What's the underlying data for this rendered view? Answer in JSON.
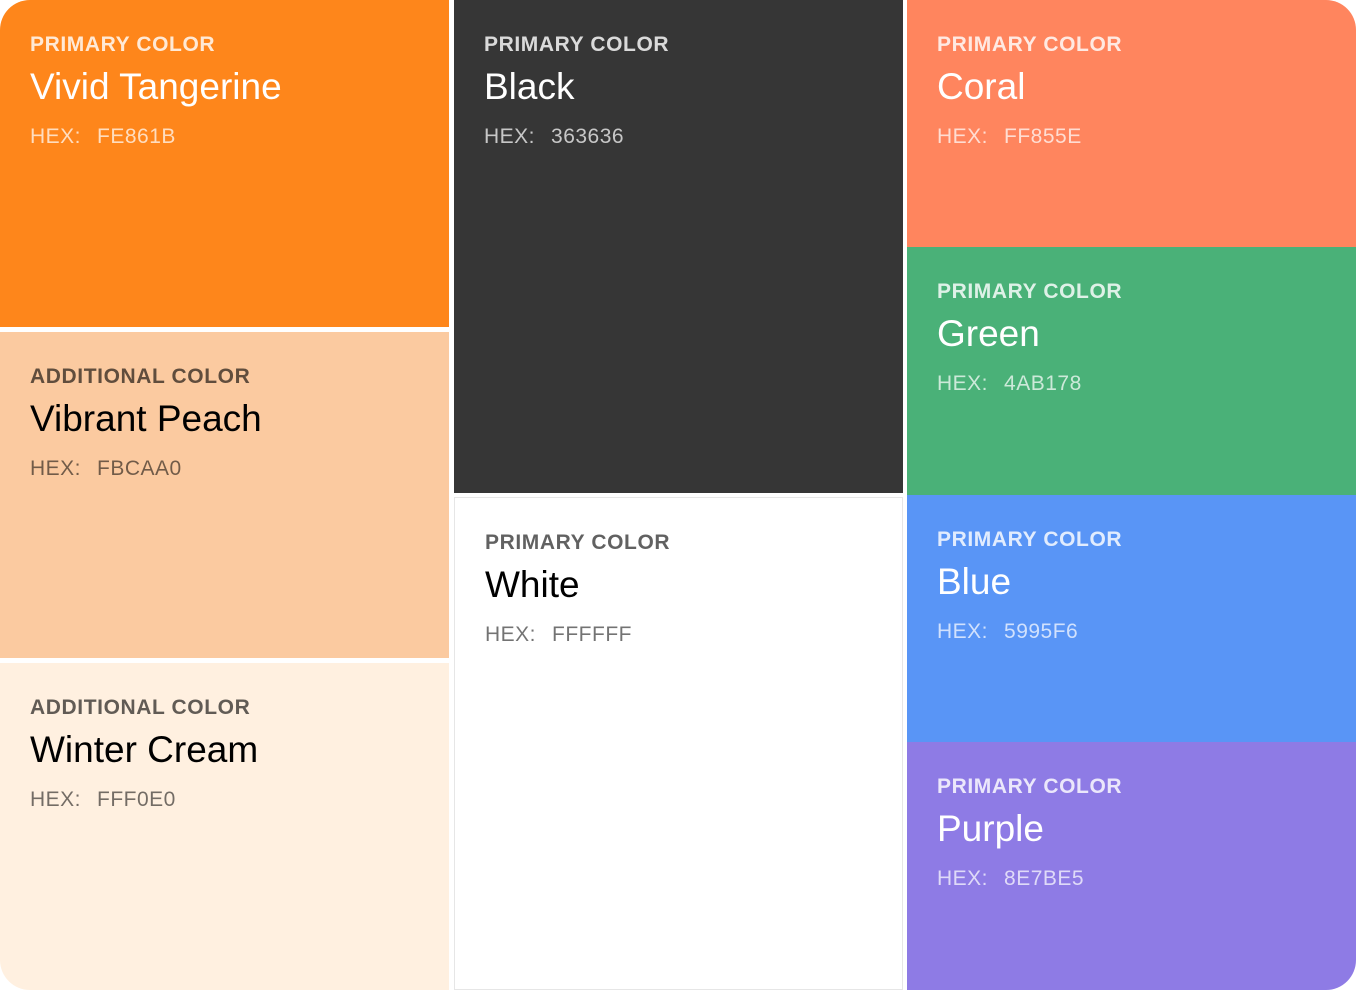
{
  "swatches": {
    "tangerine": {
      "kicker": "PRIMARY COLOR",
      "name": "Vivid Tangerine",
      "hex_label": "HEX:",
      "hex": "FE861B",
      "color": "#FE861B"
    },
    "peach": {
      "kicker": "ADDITIONAL COLOR",
      "name": "Vibrant Peach",
      "hex_label": "HEX:",
      "hex": "FBCAA0",
      "color": "#FBCAA0"
    },
    "cream": {
      "kicker": "ADDITIONAL COLOR",
      "name": "Winter Cream",
      "hex_label": "HEX:",
      "hex": "FFF0E0",
      "color": "#FFF0E0"
    },
    "black": {
      "kicker": "PRIMARY COLOR",
      "name": "Black",
      "hex_label": "HEX:",
      "hex": "363636",
      "color": "#363636"
    },
    "white": {
      "kicker": "PRIMARY COLOR",
      "name": "White",
      "hex_label": "HEX:",
      "hex": "FFFFFF",
      "color": "#FFFFFF"
    },
    "coral": {
      "kicker": "PRIMARY COLOR",
      "name": "Coral",
      "hex_label": "HEX:",
      "hex": "FF855E",
      "color": "#FF855E"
    },
    "green": {
      "kicker": "PRIMARY COLOR",
      "name": "Green",
      "hex_label": "HEX:",
      "hex": "4AB178",
      "color": "#4AB178"
    },
    "blue": {
      "kicker": "PRIMARY COLOR",
      "name": "Blue",
      "hex_label": "HEX:",
      "hex": "5995F6",
      "color": "#5995F6"
    },
    "purple": {
      "kicker": "PRIMARY COLOR",
      "name": "Purple",
      "hex_label": "HEX:",
      "hex": "8E7BE5",
      "color": "#8E7BE5"
    }
  }
}
